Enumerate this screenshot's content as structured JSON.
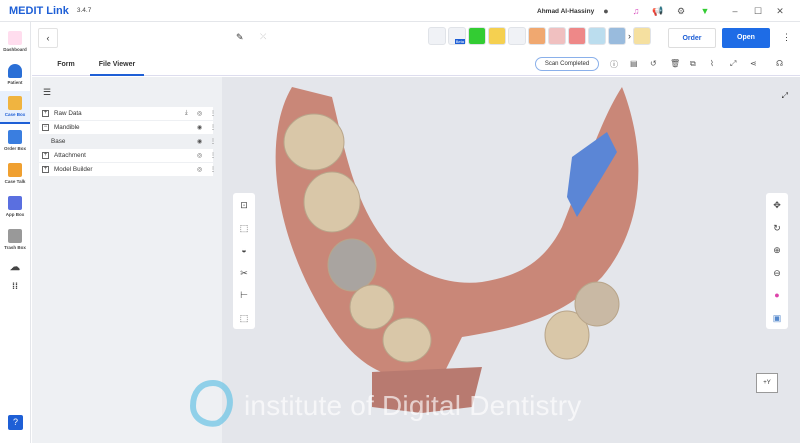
{
  "app": {
    "name": "MEDIT Link",
    "version": "3.4.7",
    "user": "Ahmad Al-Hassiny"
  },
  "sidebar": {
    "items": [
      {
        "label": "Dashboard",
        "color": "#e04a3a"
      },
      {
        "label": "Patient",
        "color": "#2a6fd6"
      },
      {
        "label": "Case Box",
        "color": "#f0b440"
      },
      {
        "label": "Order Box",
        "color": "#3a7ee0"
      },
      {
        "label": "Case Talk",
        "color": "#f0a030"
      },
      {
        "label": "App Box",
        "color": "#5a6fe0"
      },
      {
        "label": "Trash Box",
        "color": "#777"
      }
    ]
  },
  "header": {
    "tabs": [
      "Form",
      "File Viewer"
    ],
    "active_tab": "File Viewer",
    "order": "Order",
    "open": "Open",
    "status": "Scan Completed",
    "app_badge": "Beta"
  },
  "tree": {
    "items": [
      {
        "label": "Raw Data",
        "expand": "+"
      },
      {
        "label": "Mandible",
        "expand": "−"
      },
      {
        "label": "Base",
        "expand": ""
      },
      {
        "label": "Attachment",
        "expand": "+"
      },
      {
        "label": "Model Builder",
        "expand": "+"
      }
    ]
  },
  "viewport": {
    "orientation": "+Y",
    "watermark": "institute of Digital Dentistry"
  },
  "colors": {
    "accent": "#1e5fd6",
    "gingiva": "#c98778",
    "tooth": "#d9c7a8",
    "attachment": "#5b86d6"
  }
}
